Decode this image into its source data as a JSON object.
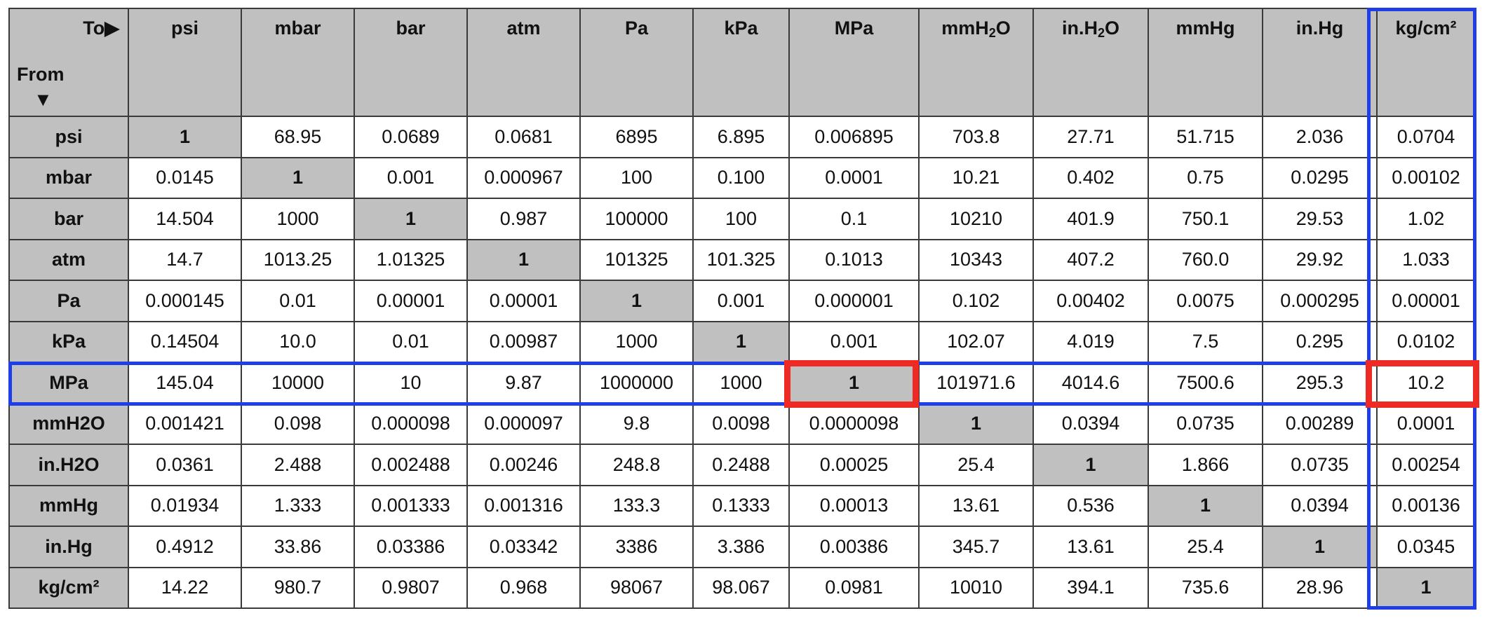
{
  "table": {
    "corner": {
      "to_label": "To",
      "to_arrow": "▶",
      "from_label": "From",
      "from_arrow": "▼"
    },
    "columns": [
      "psi",
      "mbar",
      "bar",
      "atm",
      "Pa",
      "kPa",
      "MPa",
      "mmH2O",
      "in.H2O",
      "mmHg",
      "in.Hg",
      "kg/cm²"
    ],
    "rows": [
      {
        "unit": "psi",
        "values": [
          "1",
          "68.95",
          "0.0689",
          "0.0681",
          "6895",
          "6.895",
          "0.006895",
          "703.8",
          "27.71",
          "51.715",
          "2.036",
          "0.0704"
        ]
      },
      {
        "unit": "mbar",
        "values": [
          "0.0145",
          "1",
          "0.001",
          "0.000967",
          "100",
          "0.100",
          "0.0001",
          "10.21",
          "0.402",
          "0.75",
          "0.0295",
          "0.00102"
        ]
      },
      {
        "unit": "bar",
        "values": [
          "14.504",
          "1000",
          "1",
          "0.987",
          "100000",
          "100",
          "0.1",
          "10210",
          "401.9",
          "750.1",
          "29.53",
          "1.02"
        ]
      },
      {
        "unit": "atm",
        "values": [
          "14.7",
          "1013.25",
          "1.01325",
          "1",
          "101325",
          "101.325",
          "0.1013",
          "10343",
          "407.2",
          "760.0",
          "29.92",
          "1.033"
        ]
      },
      {
        "unit": "Pa",
        "values": [
          "0.000145",
          "0.01",
          "0.00001",
          "0.00001",
          "1",
          "0.001",
          "0.000001",
          "0.102",
          "0.00402",
          "0.0075",
          "0.000295",
          "0.00001"
        ]
      },
      {
        "unit": "kPa",
        "values": [
          "0.14504",
          "10.0",
          "0.01",
          "0.00987",
          "1000",
          "1",
          "0.001",
          "102.07",
          "4.019",
          "7.5",
          "0.295",
          "0.0102"
        ]
      },
      {
        "unit": "MPa",
        "values": [
          "145.04",
          "10000",
          "10",
          "9.87",
          "1000000",
          "1000",
          "1",
          "101971.6",
          "4014.6",
          "7500.6",
          "295.3",
          "10.2"
        ]
      },
      {
        "unit": "mmH2O",
        "values": [
          "0.001421",
          "0.098",
          "0.000098",
          "0.000097",
          "9.8",
          "0.0098",
          "0.0000098",
          "1",
          "0.0394",
          "0.0735",
          "0.00289",
          "0.0001"
        ]
      },
      {
        "unit": "in.H2O",
        "values": [
          "0.0361",
          "2.488",
          "0.002488",
          "0.00246",
          "248.8",
          "0.2488",
          "0.00025",
          "25.4",
          "1",
          "1.866",
          "0.0735",
          "0.00254"
        ]
      },
      {
        "unit": "mmHg",
        "values": [
          "0.01934",
          "1.333",
          "0.001333",
          "0.001316",
          "133.3",
          "0.1333",
          "0.00013",
          "13.61",
          "0.536",
          "1",
          "0.0394",
          "0.00136"
        ]
      },
      {
        "unit": "in.Hg",
        "values": [
          "0.4912",
          "33.86",
          "0.03386",
          "0.03342",
          "3386",
          "3.386",
          "0.00386",
          "345.7",
          "13.61",
          "25.4",
          "1",
          "0.0345"
        ]
      },
      {
        "unit": "kg/cm²",
        "values": [
          "14.22",
          "980.7",
          "0.9807",
          "0.968",
          "98067",
          "98.067",
          "0.0981",
          "10010",
          "394.1",
          "735.6",
          "28.96",
          "1"
        ]
      }
    ]
  },
  "highlights": {
    "row": "MPa",
    "column": "kg/cm²",
    "cells": [
      {
        "from": "MPa",
        "to": "MPa",
        "value": "1"
      },
      {
        "from": "MPa",
        "to": "kg/cm²",
        "value": "10.2"
      }
    ],
    "colors": {
      "row_col_outline": "#1e3fe8",
      "cell_outline": "#ee2a24",
      "header_fill": "#c0c0c0"
    }
  }
}
